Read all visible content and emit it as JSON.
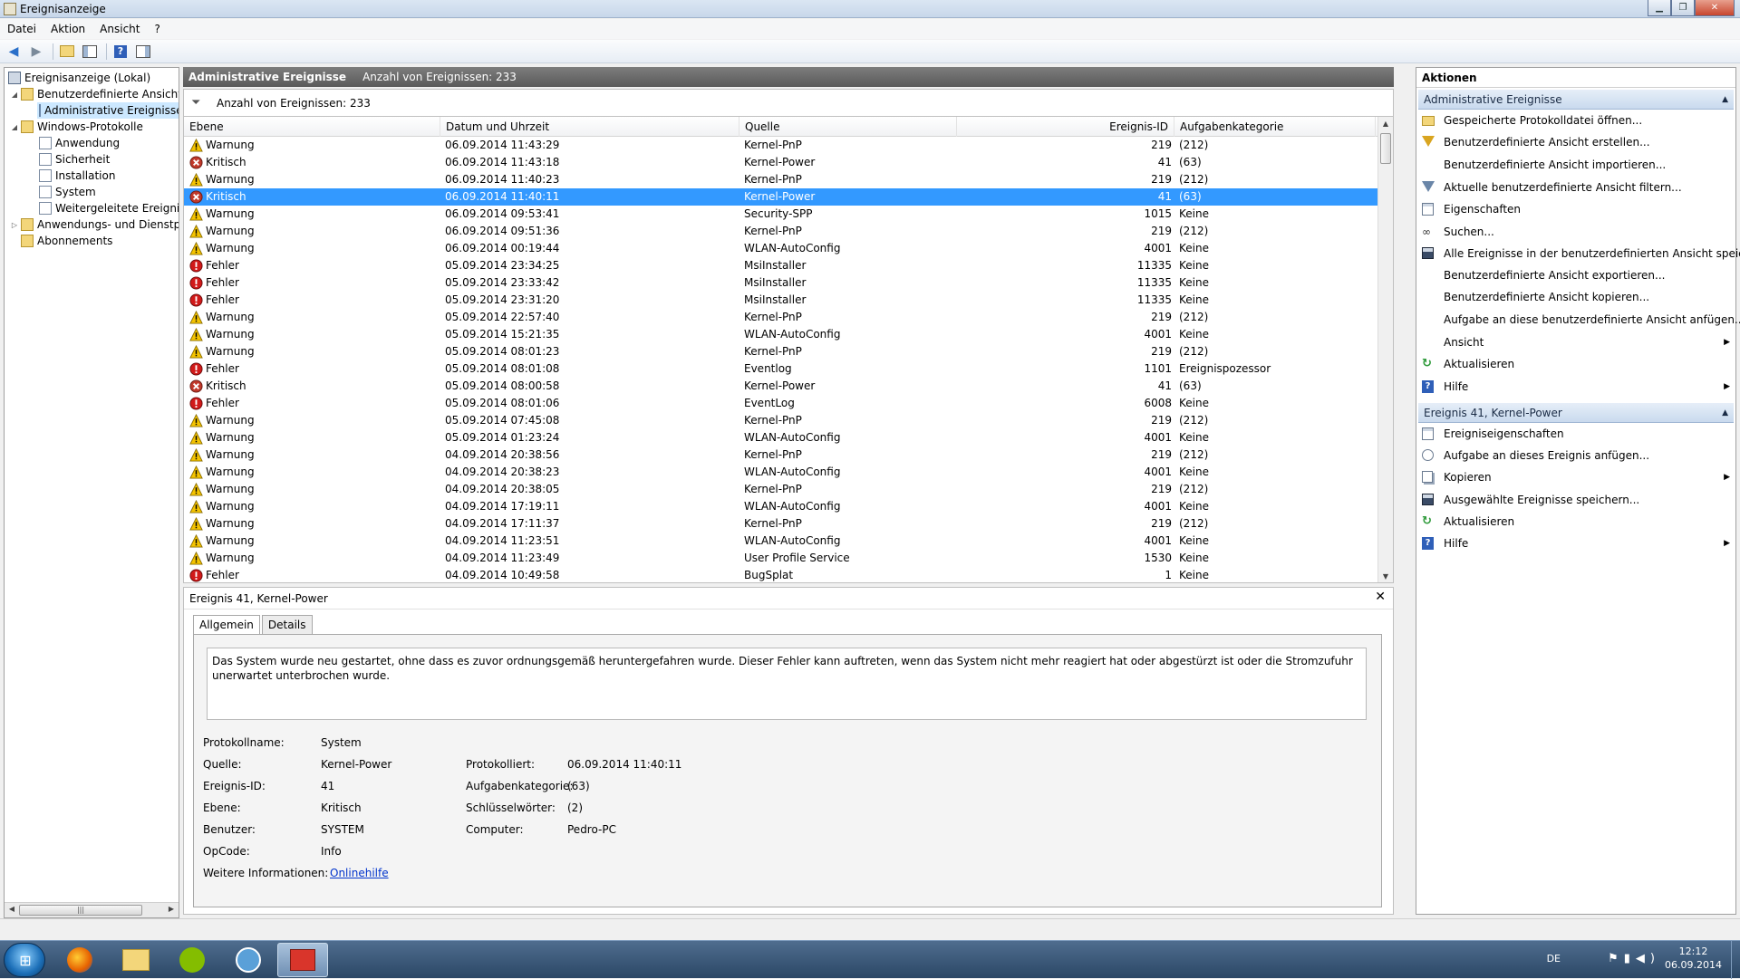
{
  "window": {
    "title": "Ereignisanzeige"
  },
  "menu": [
    "Datei",
    "Aktion",
    "Ansicht",
    "?"
  ],
  "tree": {
    "root": "Ereignisanzeige (Lokal)",
    "custom_views": "Benutzerdefinierte Ansichten",
    "admin_events": "Administrative Ereignisse",
    "windows_logs": "Windows-Protokolle",
    "app": "Anwendung",
    "security": "Sicherheit",
    "installation": "Installation",
    "system": "System",
    "forwarded": "Weitergeleitete Ereignisse",
    "apps_services": "Anwendungs- und Dienstprotokolle",
    "subscriptions": "Abonnements"
  },
  "center": {
    "header_title": "Administrative Ereignisse",
    "header_count": "Anzahl von Ereignissen: 233",
    "filter_count": "Anzahl von Ereignissen: 233",
    "columns": {
      "level": "Ebene",
      "date": "Datum und Uhrzeit",
      "source": "Quelle",
      "id": "Ereignis-ID",
      "category": "Aufgabenkategorie"
    }
  },
  "events": [
    {
      "level": "Warnung",
      "type": "warn",
      "date": "06.09.2014 11:43:29",
      "source": "Kernel-PnP",
      "id": "219",
      "category": "(212)"
    },
    {
      "level": "Kritisch",
      "type": "crit",
      "date": "06.09.2014 11:43:18",
      "source": "Kernel-Power",
      "id": "41",
      "category": "(63)"
    },
    {
      "level": "Warnung",
      "type": "warn",
      "date": "06.09.2014 11:40:23",
      "source": "Kernel-PnP",
      "id": "219",
      "category": "(212)"
    },
    {
      "level": "Kritisch",
      "type": "crit",
      "date": "06.09.2014 11:40:11",
      "source": "Kernel-Power",
      "id": "41",
      "category": "(63)",
      "selected": true
    },
    {
      "level": "Warnung",
      "type": "warn",
      "date": "06.09.2014 09:53:41",
      "source": "Security-SPP",
      "id": "1015",
      "category": "Keine"
    },
    {
      "level": "Warnung",
      "type": "warn",
      "date": "06.09.2014 09:51:36",
      "source": "Kernel-PnP",
      "id": "219",
      "category": "(212)"
    },
    {
      "level": "Warnung",
      "type": "warn",
      "date": "06.09.2014 00:19:44",
      "source": "WLAN-AutoConfig",
      "id": "4001",
      "category": "Keine"
    },
    {
      "level": "Fehler",
      "type": "err",
      "date": "05.09.2014 23:34:25",
      "source": "MsiInstaller",
      "id": "11335",
      "category": "Keine"
    },
    {
      "level": "Fehler",
      "type": "err",
      "date": "05.09.2014 23:33:42",
      "source": "MsiInstaller",
      "id": "11335",
      "category": "Keine"
    },
    {
      "level": "Fehler",
      "type": "err",
      "date": "05.09.2014 23:31:20",
      "source": "MsiInstaller",
      "id": "11335",
      "category": "Keine"
    },
    {
      "level": "Warnung",
      "type": "warn",
      "date": "05.09.2014 22:57:40",
      "source": "Kernel-PnP",
      "id": "219",
      "category": "(212)"
    },
    {
      "level": "Warnung",
      "type": "warn",
      "date": "05.09.2014 15:21:35",
      "source": "WLAN-AutoConfig",
      "id": "4001",
      "category": "Keine"
    },
    {
      "level": "Warnung",
      "type": "warn",
      "date": "05.09.2014 08:01:23",
      "source": "Kernel-PnP",
      "id": "219",
      "category": "(212)"
    },
    {
      "level": "Fehler",
      "type": "err",
      "date": "05.09.2014 08:01:08",
      "source": "Eventlog",
      "id": "1101",
      "category": "Ereignispozessor"
    },
    {
      "level": "Kritisch",
      "type": "crit",
      "date": "05.09.2014 08:00:58",
      "source": "Kernel-Power",
      "id": "41",
      "category": "(63)"
    },
    {
      "level": "Fehler",
      "type": "err",
      "date": "05.09.2014 08:01:06",
      "source": "EventLog",
      "id": "6008",
      "category": "Keine"
    },
    {
      "level": "Warnung",
      "type": "warn",
      "date": "05.09.2014 07:45:08",
      "source": "Kernel-PnP",
      "id": "219",
      "category": "(212)"
    },
    {
      "level": "Warnung",
      "type": "warn",
      "date": "05.09.2014 01:23:24",
      "source": "WLAN-AutoConfig",
      "id": "4001",
      "category": "Keine"
    },
    {
      "level": "Warnung",
      "type": "warn",
      "date": "04.09.2014 20:38:56",
      "source": "Kernel-PnP",
      "id": "219",
      "category": "(212)"
    },
    {
      "level": "Warnung",
      "type": "warn",
      "date": "04.09.2014 20:38:23",
      "source": "WLAN-AutoConfig",
      "id": "4001",
      "category": "Keine"
    },
    {
      "level": "Warnung",
      "type": "warn",
      "date": "04.09.2014 20:38:05",
      "source": "Kernel-PnP",
      "id": "219",
      "category": "(212)"
    },
    {
      "level": "Warnung",
      "type": "warn",
      "date": "04.09.2014 17:19:11",
      "source": "WLAN-AutoConfig",
      "id": "4001",
      "category": "Keine"
    },
    {
      "level": "Warnung",
      "type": "warn",
      "date": "04.09.2014 17:11:37",
      "source": "Kernel-PnP",
      "id": "219",
      "category": "(212)"
    },
    {
      "level": "Warnung",
      "type": "warn",
      "date": "04.09.2014 11:23:51",
      "source": "WLAN-AutoConfig",
      "id": "4001",
      "category": "Keine"
    },
    {
      "level": "Warnung",
      "type": "warn",
      "date": "04.09.2014 11:23:49",
      "source": "User Profile Service",
      "id": "1530",
      "category": "Keine"
    },
    {
      "level": "Fehler",
      "type": "err",
      "date": "04.09.2014 10:49:58",
      "source": "BugSplat",
      "id": "1",
      "category": "Keine"
    }
  ],
  "detail": {
    "title": "Ereignis 41, Kernel-Power",
    "tabs": [
      "Allgemein",
      "Details"
    ],
    "description": "Das System wurde neu gestartet, ohne dass es zuvor ordnungsgemäß heruntergefahren wurde. Dieser Fehler kann auftreten, wenn das System nicht mehr reagiert hat oder abgestürzt ist oder die Stromzufuhr unerwartet unterbrochen wurde.",
    "fields": {
      "log_name_label": "Protokollname:",
      "log_name": "System",
      "source_label": "Quelle:",
      "source": "Kernel-Power",
      "logged_label": "Protokolliert:",
      "logged": "06.09.2014 11:40:11",
      "event_id_label": "Ereignis-ID:",
      "event_id": "41",
      "task_cat_label": "Aufgabenkategorie:",
      "task_cat": "(63)",
      "level_label": "Ebene:",
      "level": "Kritisch",
      "keywords_label": "Schlüsselwörter:",
      "keywords": "(2)",
      "user_label": "Benutzer:",
      "user": "SYSTEM",
      "computer_label": "Computer:",
      "computer": "Pedro-PC",
      "opcode_label": "OpCode:",
      "opcode": "Info",
      "more_info_label": "Weitere Informationen:",
      "more_info": "Onlinehilfe"
    }
  },
  "actions": {
    "title": "Aktionen",
    "section1": "Administrative Ereignisse",
    "items1": [
      {
        "label": "Gespeicherte Protokolldatei öffnen...",
        "icon": "folder-open-icon"
      },
      {
        "label": "Benutzerdefinierte Ansicht erstellen...",
        "icon": "filter-create-icon"
      },
      {
        "label": "Benutzerdefinierte Ansicht importieren...",
        "icon": ""
      },
      {
        "label": "Aktuelle benutzerdefinierte Ansicht filtern...",
        "icon": "filter-icon"
      },
      {
        "label": "Eigenschaften",
        "icon": "properties-icon"
      },
      {
        "label": "Suchen...",
        "icon": "binoculars-icon"
      },
      {
        "label": "Alle Ereignisse in der benutzerdefinierten Ansicht speic...",
        "icon": "save-icon"
      },
      {
        "label": "Benutzerdefinierte Ansicht exportieren...",
        "icon": ""
      },
      {
        "label": "Benutzerdefinierte Ansicht kopieren...",
        "icon": ""
      },
      {
        "label": "Aufgabe an diese benutzerdefinierte Ansicht anfügen...",
        "icon": ""
      },
      {
        "label": "Ansicht",
        "icon": "",
        "submenu": true
      },
      {
        "label": "Aktualisieren",
        "icon": "refresh-icon"
      },
      {
        "label": "Hilfe",
        "icon": "help-icon",
        "submenu": true
      }
    ],
    "section2": "Ereignis 41, Kernel-Power",
    "items2": [
      {
        "label": "Ereigniseigenschaften",
        "icon": "properties-icon"
      },
      {
        "label": "Aufgabe an dieses Ereignis anfügen...",
        "icon": "task-icon"
      },
      {
        "label": "Kopieren",
        "icon": "copy-icon",
        "submenu": true
      },
      {
        "label": "Ausgewählte Ereignisse speichern...",
        "icon": "save-icon"
      },
      {
        "label": "Aktualisieren",
        "icon": "refresh-icon"
      },
      {
        "label": "Hilfe",
        "icon": "help-icon",
        "submenu": true
      }
    ]
  },
  "taskbar": {
    "lang": "DE",
    "time": "12:12",
    "date": "06.09.2014"
  },
  "colors": {
    "selection": "#3399ff",
    "warn": "#f5c400",
    "crit": "#c0392b",
    "err": "#d11a1a"
  }
}
